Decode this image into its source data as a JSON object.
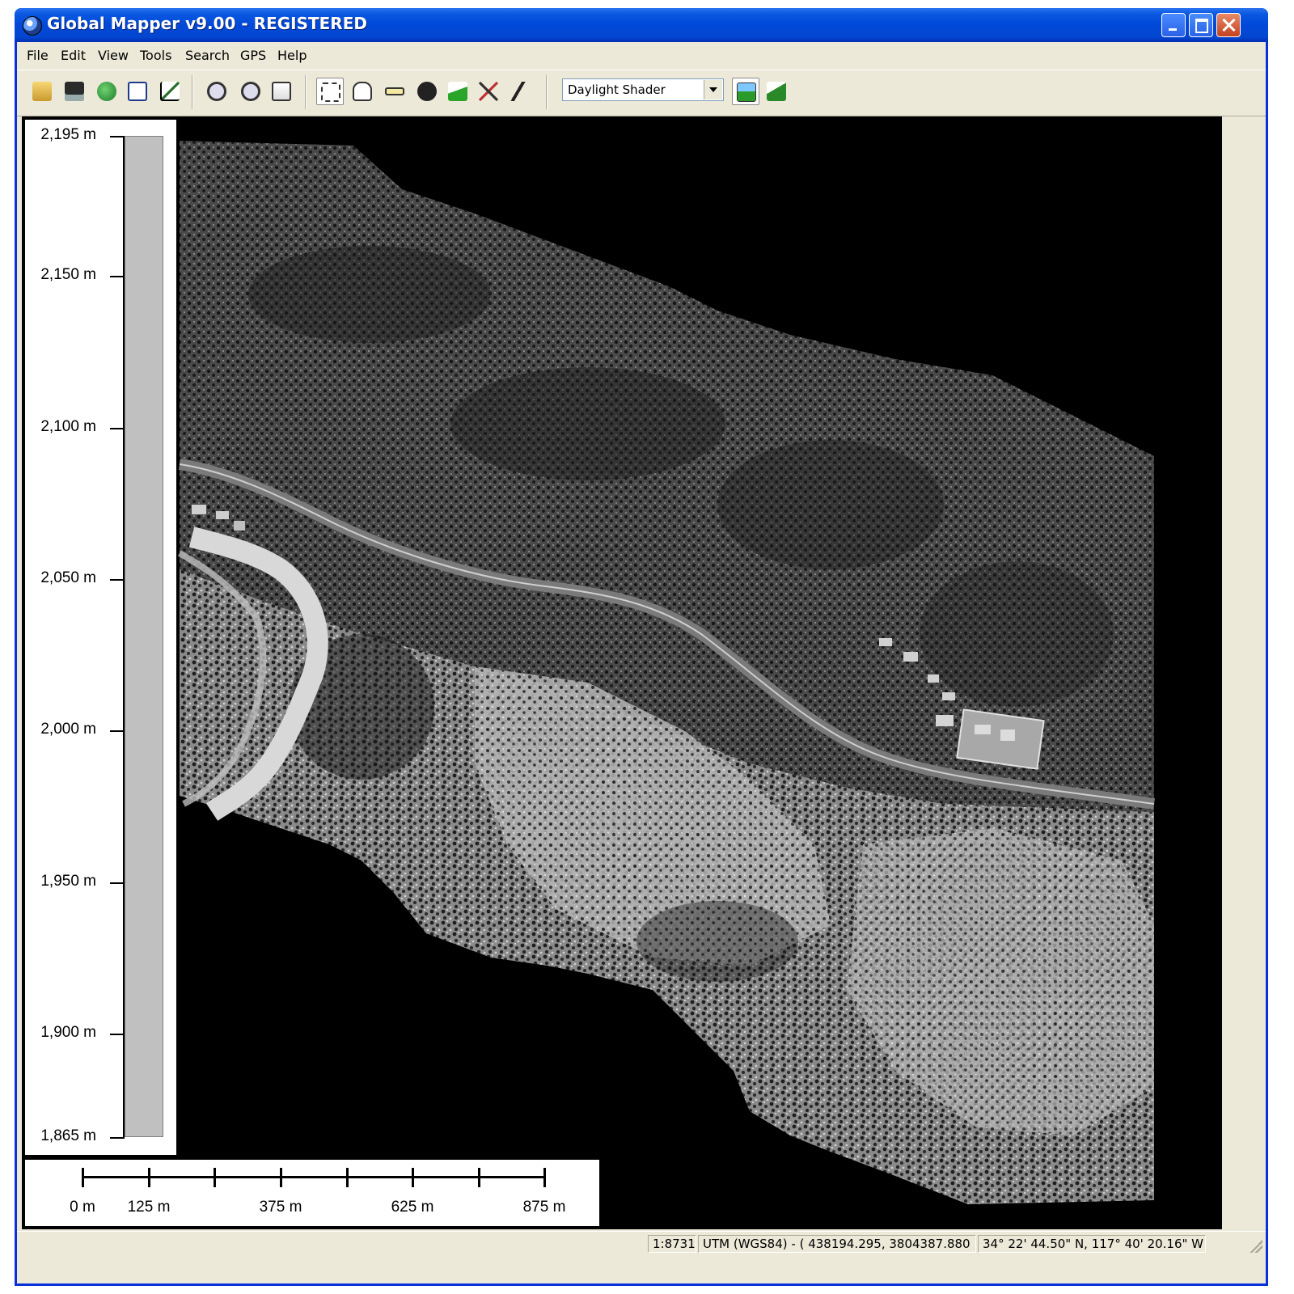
{
  "window": {
    "title": "Global Mapper v9.00 - REGISTERED"
  },
  "menu": {
    "items": [
      "File",
      "Edit",
      "View",
      "Tools",
      "Search",
      "GPS",
      "Help"
    ]
  },
  "toolbar": {
    "icons": [
      "open-icon",
      "save-icon",
      "globe-icon",
      "zoom-extent-icon",
      "chart-icon",
      "zoom-in-icon",
      "zoom-out-icon",
      "home-icon",
      "select-icon",
      "pan-icon",
      "measure-icon",
      "info-icon",
      "path-profile-icon",
      "digitizer-icon",
      "draw-icon",
      "shader-settings-icon",
      "3d-view-icon"
    ],
    "shader_select_value": "Daylight Shader"
  },
  "elevation_legend": {
    "labels": [
      "2,195 m",
      "2,150 m",
      "2,100 m",
      "2,050 m",
      "2,000 m",
      "1,950 m",
      "1,900 m",
      "1,865 m"
    ],
    "values_m": [
      2195,
      2150,
      2100,
      2050,
      2000,
      1950,
      1900,
      1865
    ]
  },
  "scale_bar": {
    "labels": [
      "0 m",
      "125 m",
      "375 m",
      "625 m",
      "875 m"
    ]
  },
  "status": {
    "scale": "1:8731",
    "projection": "UTM (WGS84) - ( 438194.295, 3804387.880 )",
    "geo_coords": "34° 22' 44.50\" N, 117° 40' 20.16\" W"
  }
}
